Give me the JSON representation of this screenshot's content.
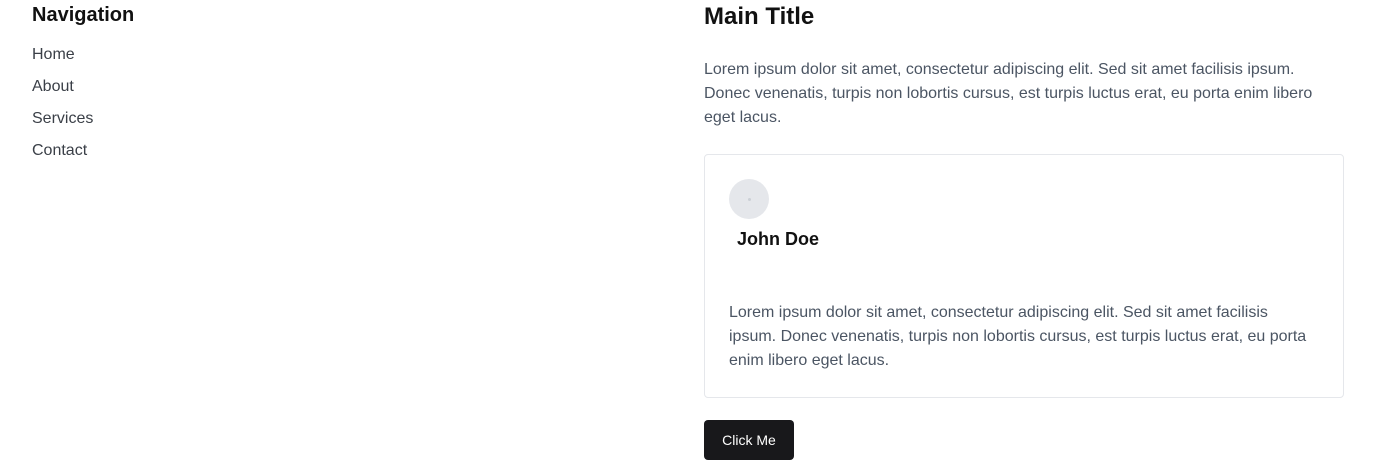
{
  "sidebar": {
    "title": "Navigation",
    "items": [
      {
        "label": "Home"
      },
      {
        "label": "About"
      },
      {
        "label": "Services"
      },
      {
        "label": "Contact"
      }
    ]
  },
  "main": {
    "title": "Main Title",
    "intro": "Lorem ipsum dolor sit amet, consectetur adipiscing elit. Sed sit amet facilisis ipsum. Donec venenatis, turpis non lobortis cursus, est turpis luctus erat, eu porta enim libero eget lacus.",
    "card": {
      "avatar_icon": "avatar-placeholder-icon",
      "name": "John Doe",
      "text": "Lorem ipsum dolor sit amet, consectetur adipiscing elit. Sed sit amet facilisis ipsum. Donec venenatis, turpis non lobortis cursus, est turpis luctus erat, eu porta enim libero eget lacus."
    },
    "button_label": "Click Me"
  },
  "colors": {
    "button_bg": "#18181b",
    "border": "#e5e7eb",
    "muted_text": "#4b5563"
  }
}
